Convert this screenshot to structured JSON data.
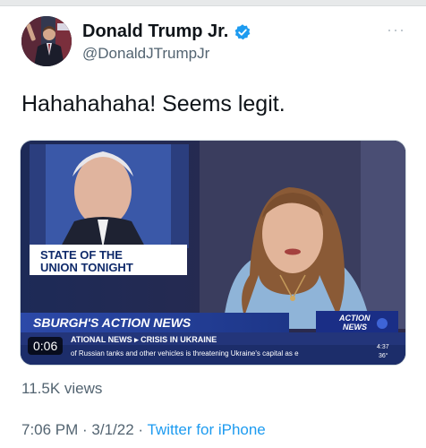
{
  "tweet": {
    "display_name": "Donald Trump Jr.",
    "handle": "@DonaldJTrumpJr",
    "more_glyph": "···",
    "text": "Hahahahaha! Seems legit.",
    "views": "11.5K views",
    "timestamp": "7:06 PM · 3/1/22 · ",
    "source": "Twitter for iPhone"
  },
  "video": {
    "duration": "0:06",
    "lower_third_line1": "STATE OF THE",
    "lower_third_line2": "UNION TONIGHT",
    "station_banner": "SBURGH'S ACTION NEWS",
    "station_logo_line1": "ACTION",
    "station_logo_line2": "NEWS",
    "ticker_top": "ATIONAL NEWS ▸ CRISIS IN UKRAINE",
    "ticker_bottom": "of Russian tanks and other vehicles is threatening Ukraine's capital as e",
    "ticker_time": "4:37",
    "ticker_temp": "36°"
  },
  "colors": {
    "verified_blue": "#1d9bf0",
    "link_blue": "#1d9bf0",
    "secondary_text": "#536471"
  }
}
